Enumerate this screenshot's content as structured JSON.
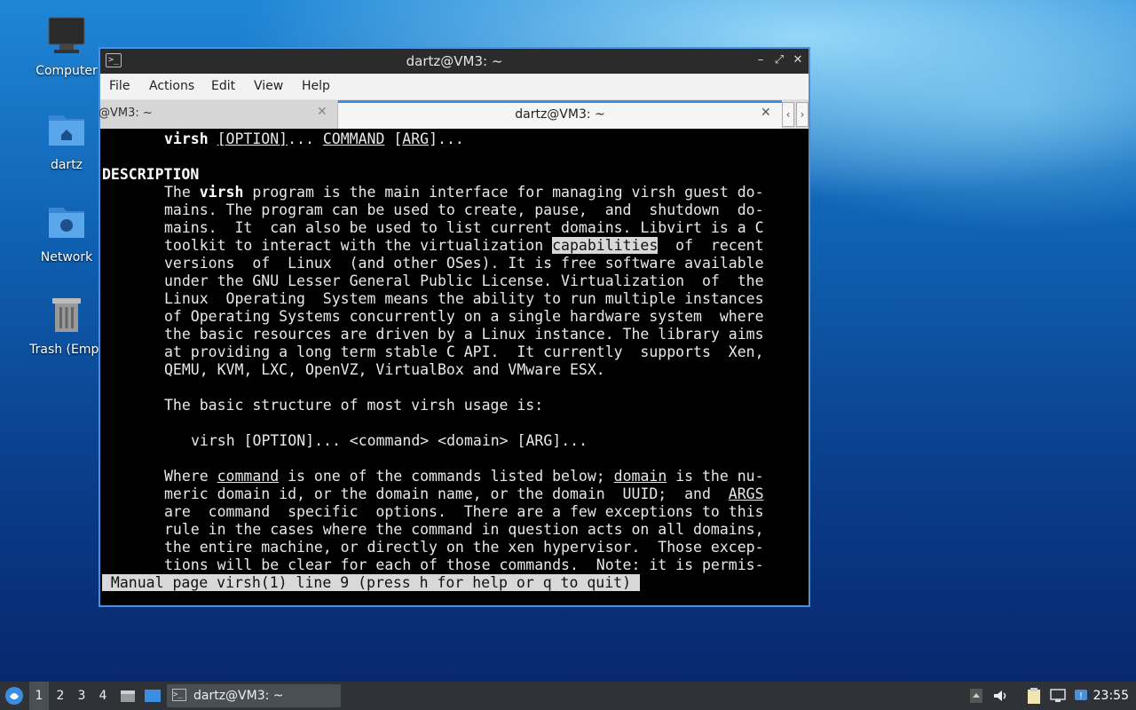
{
  "desktop": {
    "icons": [
      {
        "label": "Computer",
        "icon": "monitor-icon"
      },
      {
        "label": "dartz",
        "icon": "home-folder-icon"
      },
      {
        "label": "Network",
        "icon": "network-folder-icon"
      },
      {
        "label": "Trash (Empt",
        "icon": "trash-icon"
      }
    ]
  },
  "window": {
    "title": "dartz@VM3: ~",
    "controls": {
      "minimize": "–",
      "maximize": "⤢",
      "close": "✕"
    },
    "menu": [
      "File",
      "Actions",
      "Edit",
      "View",
      "Help"
    ],
    "tabs": [
      {
        "label": "@VM3: ~",
        "close": "✕"
      },
      {
        "label": "dartz@VM3: ~",
        "close": "✕",
        "active": true
      }
    ],
    "tab_nav": {
      "prev": "‹",
      "next": "›"
    }
  },
  "terminal": {
    "synopsis": {
      "cmd": "virsh",
      "opt": "[OPTION]",
      "dots1": "... ",
      "command": "COMMAND",
      "sp": " [",
      "arg": "ARG",
      "end": "]..."
    },
    "heading": "DESCRIPTION",
    "p1": {
      "l1a": "The ",
      "l1b": "virsh",
      "l1c": " program is the main interface for managing virsh guest do-",
      "l2": "mains. The program can be used to create, pause,  and  shutdown  do-",
      "l3": "mains.  It  can also be used to list current domains. Libvirt is a C",
      "l4a": "toolkit to interact with the virtualization ",
      "l4b": "capabilities",
      "l4c": "  of  recent",
      "l5": "versions  of  Linux  (and other OSes). It is free software available",
      "l6": "under the GNU Lesser General Public License. Virtualization  of  the",
      "l7": "Linux  Operating  System means the ability to run multiple instances",
      "l8": "of Operating Systems concurrently on a single hardware system  where",
      "l9": "the basic resources are driven by a Linux instance. The library aims",
      "l10": "at providing a long term stable C API.  It currently  supports  Xen,",
      "l11": "QEMU, KVM, LXC, OpenVZ, VirtualBox and VMware ESX."
    },
    "p2": "The basic structure of most virsh usage is:",
    "p3": "virsh [OPTION]... <command> <domain> [ARG]...",
    "p4": {
      "l1a": "Where ",
      "l1b": "command",
      "l1c": " is one of the commands listed below; ",
      "l1d": "domain",
      "l1e": " is the nu-",
      "l2a": "meric domain id, or the domain name, or the domain  UUID;  and  ",
      "l2b": "ARGS",
      "l3": "are  command  specific  options.  There are a few exceptions to this",
      "l4": "rule in the cases where the command in question acts on all domains,",
      "l5": "the entire machine, or directly on the xen hypervisor.  Those excep-",
      "l6": "tions will be clear for each of those commands.  Note: it is permis-"
    },
    "status": " Manual page virsh(1) line 9 (press h for help or q to quit) "
  },
  "taskbar": {
    "workspaces": [
      "1",
      "2",
      "3",
      "4"
    ],
    "active_workspace": "1",
    "task_label": "dartz@VM3: ~",
    "clock": "23:55"
  }
}
